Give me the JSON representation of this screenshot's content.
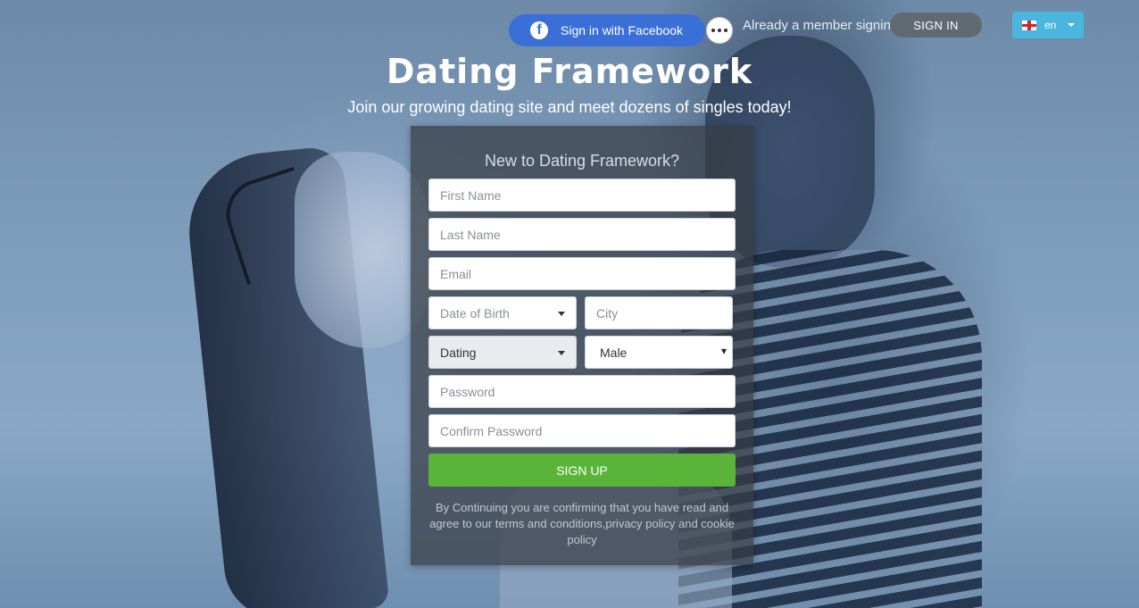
{
  "header": {
    "facebook_button": "Sign in with Facebook",
    "member_text": "Already a member signin",
    "signin_button": "SIGN IN",
    "language": "en"
  },
  "hero": {
    "title": "Dating Framework",
    "subtitle": "Join our growing dating site and meet dozens of singles today!"
  },
  "form": {
    "title": "New to Dating Framework?",
    "first_name_placeholder": "First Name",
    "last_name_placeholder": "Last Name",
    "email_placeholder": "Email",
    "dob_placeholder": "Date of Birth",
    "city_placeholder": "City",
    "relationship_value": "Dating",
    "gender_value": "Male",
    "password_placeholder": "Password",
    "confirm_password_placeholder": "Confirm Password",
    "signup_button": "SIGN UP",
    "terms_text": "By Continuing you are confirming that you have read and agree to our terms and conditions,privacy policy and cookie policy"
  },
  "colors": {
    "facebook": "#3b6fd8",
    "signup": "#5bb43a",
    "language_button": "#4ab6de"
  }
}
